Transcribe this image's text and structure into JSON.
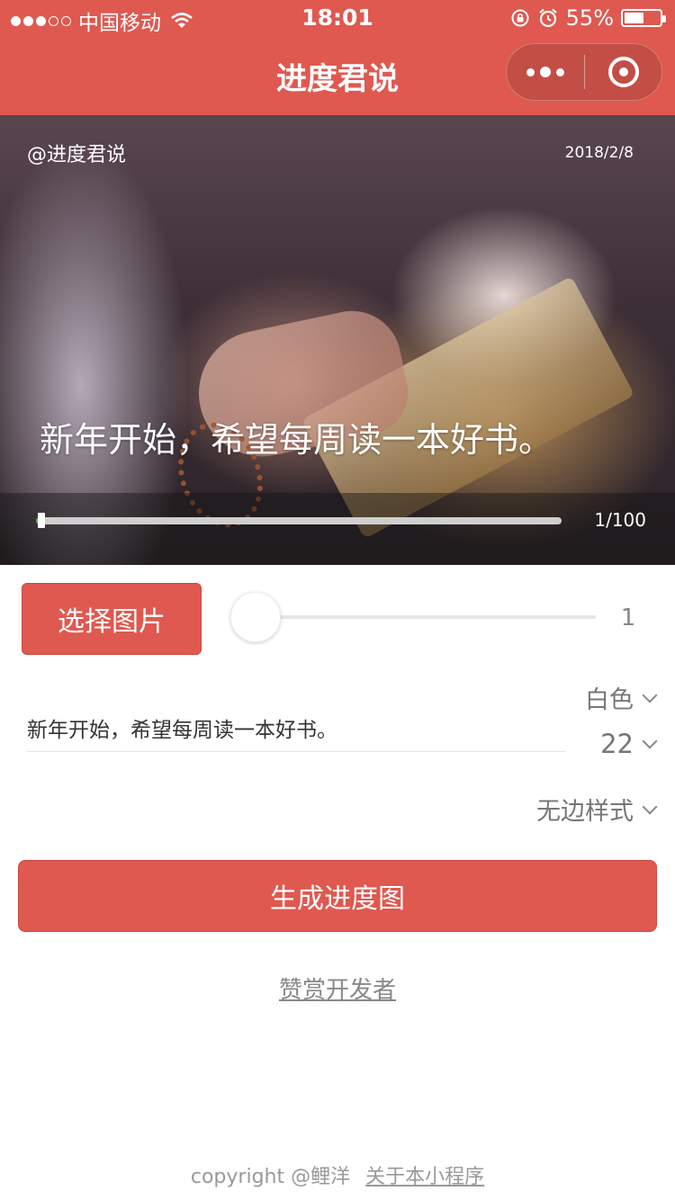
{
  "status_bar": {
    "carrier": "中国移动",
    "time": "18:01",
    "battery_percent": "55%",
    "battery_level": 0.55,
    "signal_bars": 3,
    "signal_total": 5
  },
  "nav": {
    "title": "进度君说"
  },
  "preview": {
    "brand": "@进度君说",
    "date": "2018/2/8",
    "text": "新年开始，希望每周读一本好书。",
    "progress_label": "1/100",
    "progress_value": 1,
    "progress_max": 100
  },
  "controls": {
    "choose_image_label": "选择图片",
    "slider_value": "1",
    "text_input_value": "新年开始，希望每周读一本好书。",
    "color_picker_value": "白色",
    "size_picker_value": "22",
    "style_picker_value": "无边样式",
    "generate_label": "生成进度图",
    "reward_link": "赞赏开发者"
  },
  "footer": {
    "copyright": "copyright @鲤洋",
    "about_link": "关于本小程序"
  },
  "colors": {
    "brand_red": "#df5950",
    "progress_green": "#3fbd3c"
  }
}
